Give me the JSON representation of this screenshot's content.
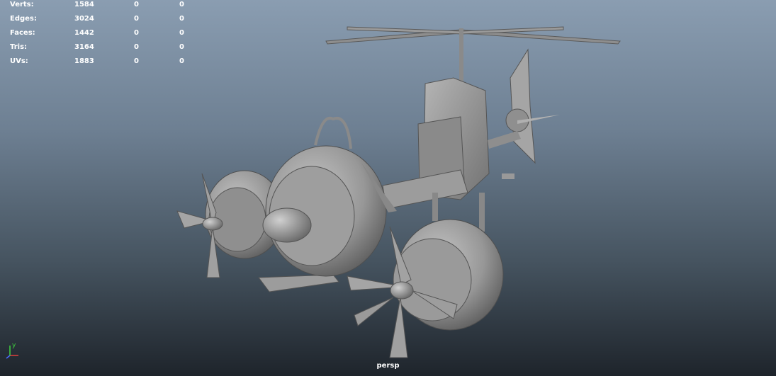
{
  "hud": {
    "rows": [
      {
        "label": "Verts:",
        "v1": "1584",
        "v2": "0",
        "v3": "0"
      },
      {
        "label": "Edges:",
        "v1": "3024",
        "v2": "0",
        "v3": "0"
      },
      {
        "label": "Faces:",
        "v1": "1442",
        "v2": "0",
        "v3": "0"
      },
      {
        "label": "Tris:",
        "v1": "3164",
        "v2": "0",
        "v3": "0"
      },
      {
        "label": "UVs:",
        "v1": "1883",
        "v2": "0",
        "v3": "0"
      }
    ]
  },
  "viewport": {
    "camera": "persp",
    "axis_y_label": "y"
  },
  "colors": {
    "bg_top": "#8a9db1",
    "bg_bottom": "#1e242b",
    "model": "#9a9a9a",
    "hud_text": "#ffffff",
    "axis_x": "#e0403c",
    "axis_y": "#3fd23f",
    "axis_z": "#4a6bff"
  }
}
